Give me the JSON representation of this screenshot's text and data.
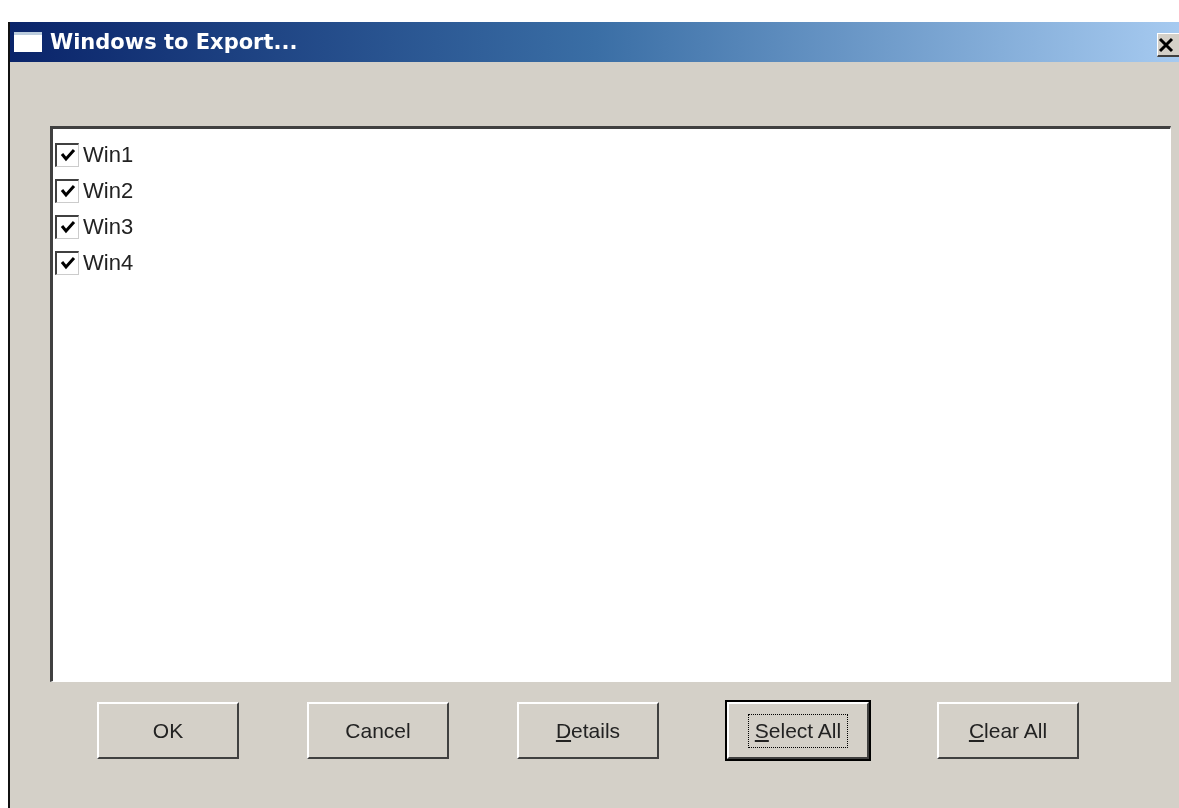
{
  "window": {
    "title": "Windows to Export..."
  },
  "items": [
    {
      "label": "Win1",
      "checked": true
    },
    {
      "label": "Win2",
      "checked": true
    },
    {
      "label": "Win3",
      "checked": true
    },
    {
      "label": "Win4",
      "checked": true
    }
  ],
  "buttons": [
    {
      "label": "OK",
      "underline_first": false,
      "focused": false
    },
    {
      "label": "Cancel",
      "underline_first": false,
      "focused": false
    },
    {
      "label": "Details",
      "underline_first": true,
      "focused": false
    },
    {
      "label": "Select All",
      "underline_first": true,
      "focused": true
    },
    {
      "label": "Clear All",
      "underline_first": true,
      "focused": false
    }
  ]
}
